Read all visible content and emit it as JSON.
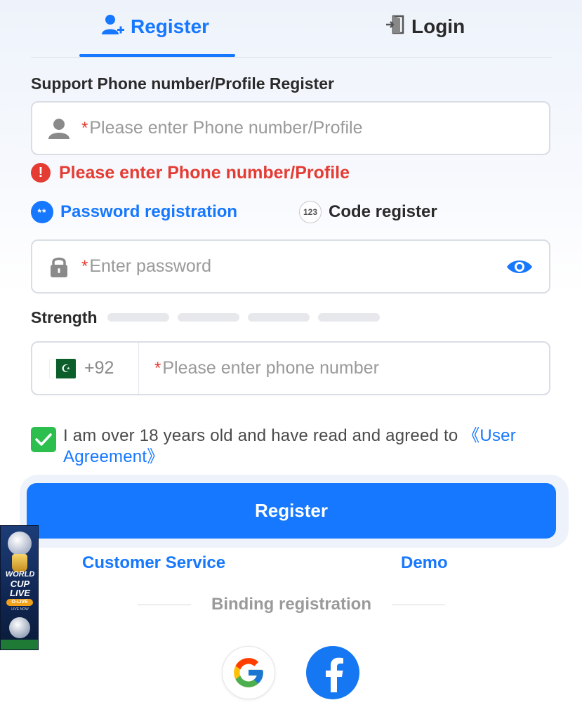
{
  "tabs": {
    "register_label": "Register",
    "login_label": "Login"
  },
  "form": {
    "section_title": "Support Phone number/Profile Register",
    "profile_placeholder": "Please enter Phone number/Profile",
    "required_mark": "*",
    "profile_error": "Please enter Phone number/Profile",
    "error_symbol": "!",
    "modes": {
      "password_label": "Password registration",
      "password_icon_text": "**",
      "code_label": "Code register",
      "code_icon_text": "123"
    },
    "password_placeholder": "Enter password",
    "strength_label": "Strength",
    "country_code": "+92",
    "phone_placeholder": "Please enter phone number",
    "agreement_text": "I am over 18 years old and have read and agreed to ",
    "agreement_link": "《User Agreement》",
    "agreement_checked": true,
    "register_button": "Register"
  },
  "links": {
    "customer_service": "Customer Service",
    "demo": "Demo"
  },
  "binding": {
    "label": "Binding registration"
  },
  "promo": {
    "line1": "WORLD",
    "line2": "CUP",
    "line3": "LIVE",
    "badge": "O-LIVE",
    "sub": "LIVE NOW"
  },
  "colors": {
    "accent": "#1677ff",
    "error": "#e43b33",
    "checkbox": "#2dbf4e",
    "facebook": "#1677f2"
  },
  "icons": {
    "register_tab": "add-user-icon",
    "login_tab": "login-door-icon",
    "profile": "user-icon",
    "password": "lock-icon",
    "visibility": "eye-icon",
    "country_flag": "pakistan-flag-icon",
    "google": "google-icon",
    "facebook": "facebook-icon"
  }
}
